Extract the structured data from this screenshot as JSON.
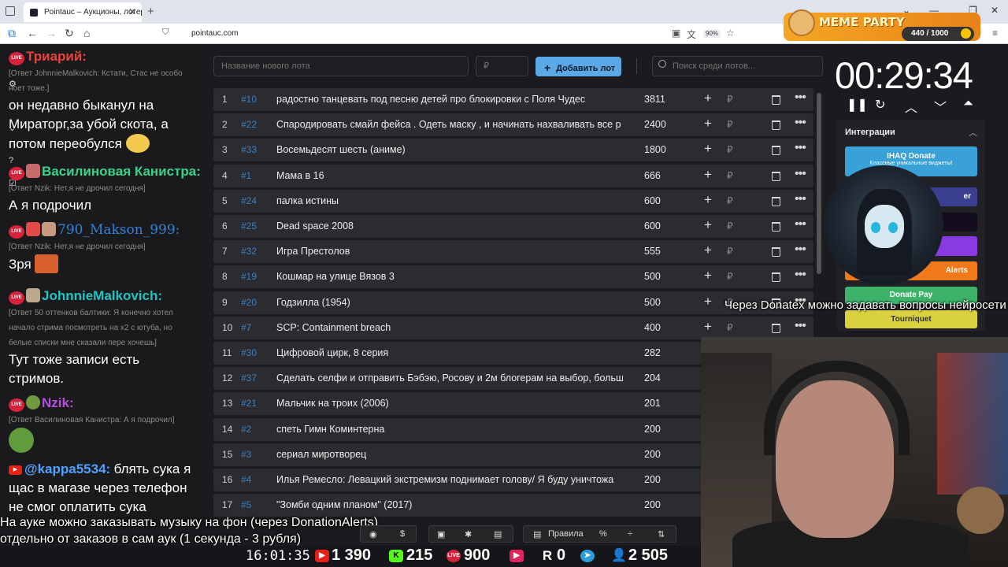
{
  "browser": {
    "tab_title": "Pointauc – Аукционы, лотереи",
    "url": "pointauc.com",
    "zoom": "90%"
  },
  "meme_party": {
    "name": "MEME PARTY",
    "counter": "440 / 1000"
  },
  "chat": {
    "messages": [
      {
        "nick": "Триарий:",
        "reply": "[Ответ JohnnieMalkovich: Кстати, Стас не особо",
        "reply2": "ноет тоже.]",
        "text": [
          "он недавно быканул на",
          "Мираторг,за убой скота, а",
          "потом переобулся"
        ]
      },
      {
        "nick": "Василиновая Канистра:",
        "reply": "[Ответ Nzik: Нет,я не дрочил сегодня]",
        "text": [
          "А я подрочил"
        ]
      },
      {
        "nick": "790_Makson_999:",
        "reply": "[Ответ Nzik: Нет,я не дрочил сегодня]",
        "text": [
          "Зря"
        ]
      },
      {
        "nick": "JohnnieMalkovich:",
        "reply": "[Ответ 50 оттенков балтики: Я конечно хотел",
        "reply2": "начало стрима посмотреть на x2 с ютуба, но",
        "reply3": "белые списки мне сказали пере хочешь]",
        "text": [
          "Тут тоже записи есть",
          "стримов."
        ]
      },
      {
        "nick": "Nzik:",
        "reply": "[Ответ Василиновая Канистра: А я подрочил]"
      },
      {
        "nick": "@kappa5534:",
        "text": [
          "блять сука я",
          "щас в магазе через телефон",
          "не смог оплатить сука"
        ]
      }
    ]
  },
  "auction": {
    "new_lot_placeholder": "Название нового лота",
    "amount_placeholder": "₽",
    "add_button": "Добавить лот",
    "search_placeholder": "Поиск среди лотов...",
    "currency": "₽",
    "lots": [
      {
        "num": "1",
        "id": "#10",
        "name": "радостно танцевать под песню детей про блокировки с Поля Чудес",
        "amount": "3811"
      },
      {
        "num": "2",
        "id": "#22",
        "name": "Спародировать смайл фейса . Одеть маску , и начинать нахваливать все р",
        "amount": "2400"
      },
      {
        "num": "3",
        "id": "#33",
        "name": "Восемьдесят шесть (аниме)",
        "amount": "1800"
      },
      {
        "num": "4",
        "id": "#1",
        "name": "Мама в 16",
        "amount": "666"
      },
      {
        "num": "5",
        "id": "#24",
        "name": "палка истины",
        "amount": "600"
      },
      {
        "num": "6",
        "id": "#25",
        "name": "Dead space 2008",
        "amount": "600"
      },
      {
        "num": "7",
        "id": "#32",
        "name": "Игра Престолов",
        "amount": "555"
      },
      {
        "num": "8",
        "id": "#19",
        "name": "Кошмар на улице Вязов 3",
        "amount": "500"
      },
      {
        "num": "9",
        "id": "#20",
        "name": "Годзилла (1954)",
        "amount": "500"
      },
      {
        "num": "10",
        "id": "#7",
        "name": "SCP: Containment breach",
        "amount": "400"
      },
      {
        "num": "11",
        "id": "#30",
        "name": "Цифровой цирк, 8 серия",
        "amount": "282"
      },
      {
        "num": "12",
        "id": "#37",
        "name": "Сделать селфи и отправить Бэбэю, Росову и 2м блогерам на выбор, больш",
        "amount": "204"
      },
      {
        "num": "13",
        "id": "#21",
        "name": "Мальчик на троих (2006)",
        "amount": "201"
      },
      {
        "num": "14",
        "id": "#2",
        "name": "спеть Гимн Коминтерна",
        "amount": "200"
      },
      {
        "num": "15",
        "id": "#3",
        "name": "сериал миротворец",
        "amount": "200"
      },
      {
        "num": "16",
        "id": "#4",
        "name": "Илья Ремесло: Левацкий экстремизм поднимает голову/ Я буду уничтожа",
        "amount": "200"
      },
      {
        "num": "17",
        "id": "#5",
        "name": "\"Зомби одним планом\" (2017)",
        "amount": "200"
      }
    ]
  },
  "timer": {
    "value": "00:29:34"
  },
  "integrations": {
    "title": "Интеграции",
    "ihaq": "IHAQ Donate",
    "ihaq_sub": "Классные уникальные виджеты!",
    "er": "er",
    "alerts": "Alerts",
    "donatepay": "Donate Pay",
    "tourniquet": "Tourniquet"
  },
  "overlays": {
    "donatex": "Через Donatex можно задавать вопросы нейросети",
    "music_line1": "На ауке можно заказывать музыку на фон (через DonationAlerts)",
    "music_line2": "отдельно от заказов в сам аук (1 секунда - 3 рубля)"
  },
  "toolbar": {
    "rules": "Правила"
  },
  "stats": {
    "clock": "16:01:35",
    "youtube": "1 390",
    "kick": "215",
    "twitch": "900",
    "rumble": "0",
    "total": "2 505"
  }
}
